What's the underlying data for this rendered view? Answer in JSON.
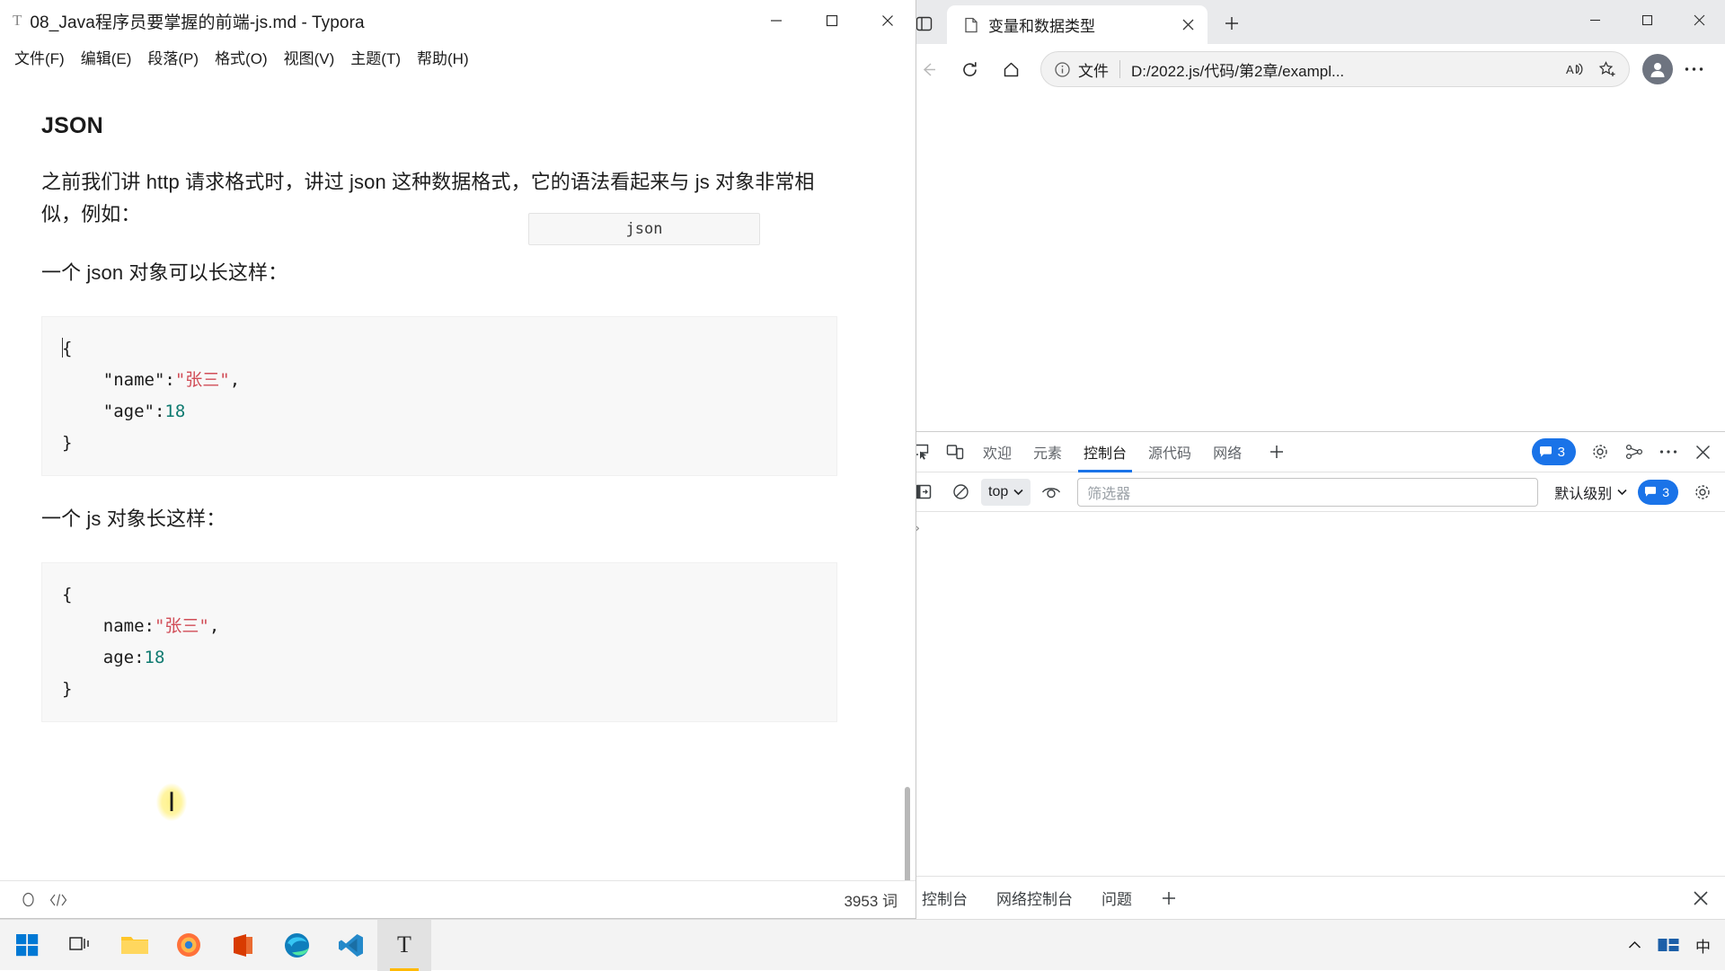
{
  "typora": {
    "app_icon": "typora-icon",
    "title": "08_Java程序员要掌握的前端-js.md - Typora",
    "menus": [
      {
        "label": "文件(F)",
        "name": "menu-file"
      },
      {
        "label": "编辑(E)",
        "name": "menu-edit"
      },
      {
        "label": "段落(P)",
        "name": "menu-paragraph"
      },
      {
        "label": "格式(O)",
        "name": "menu-format"
      },
      {
        "label": "视图(V)",
        "name": "menu-view"
      },
      {
        "label": "主题(T)",
        "name": "menu-theme"
      },
      {
        "label": "帮助(H)",
        "name": "menu-help"
      }
    ],
    "window_buttons": {
      "minimize": "minimize-icon",
      "maximize": "maximize-icon",
      "close": "close-icon"
    },
    "document": {
      "heading": "JSON",
      "paragraph_1": "之前我们讲 http 请求格式时，讲过 json 这种数据格式，它的语法看起来与 js 对象非常相似，例如：",
      "paragraph_2": "一个 json 对象可以长这样：",
      "code_block_1": {
        "language_label": "json",
        "lines": [
          {
            "open": "{"
          },
          {
            "key": "    \"name\":",
            "string": "\"张三\"",
            "after": ","
          },
          {
            "key": "    \"age\":",
            "number": "18"
          },
          {
            "open": "}"
          }
        ]
      },
      "paragraph_3": "一个 js 对象长这样：",
      "code_block_2": {
        "lines": [
          {
            "open": "{"
          },
          {
            "key": "    name:",
            "string": "\"张三\"",
            "after": ","
          },
          {
            "key": "    age:",
            "number": "18"
          },
          {
            "open": "}"
          }
        ]
      }
    },
    "status_bar": {
      "source_mode_icon": "circle-icon",
      "code_view_icon": "code-brackets-icon",
      "word_count": "3953 词"
    }
  },
  "edge": {
    "tab_actions_icon": "tab-actions-icon",
    "tabs": [
      {
        "title": "变量和数据类型",
        "favicon": "page-icon",
        "close_icon": "close-icon",
        "active": true
      }
    ],
    "new_tab_label": "+",
    "window_buttons": {
      "minimize": "minimize-icon",
      "maximize": "maximize-icon",
      "close": "close-icon"
    },
    "toolbar": {
      "back_icon": "back-arrow-icon",
      "refresh_icon": "refresh-icon",
      "home_icon": "home-icon",
      "info_icon": "info-circle-icon",
      "scheme_label": "文件",
      "url": "D:/2022.js/代码/第2章/exampl...",
      "read_aloud_icon": "read-aloud-icon",
      "favorite_icon": "star-add-icon",
      "profile_icon": "profile-avatar-icon",
      "settings_icon": "more-ellipsis-icon"
    }
  },
  "devtools": {
    "inspect_icon": "inspect-element-icon",
    "device_toolbar_icon": "device-toolbar-icon",
    "tabs": [
      {
        "label": "欢迎",
        "name": "tab-welcome",
        "active": false
      },
      {
        "label": "元素",
        "name": "tab-elements",
        "active": false
      },
      {
        "label": "控制台",
        "name": "tab-console",
        "active": true
      },
      {
        "label": "源代码",
        "name": "tab-sources",
        "active": false
      },
      {
        "label": "网络",
        "name": "tab-network",
        "active": false
      }
    ],
    "more_tabs_icon": "plus-icon",
    "issues_badge": "3",
    "settings_icon": "gear-icon",
    "customize_icon": "devtools-customize-icon",
    "more_icon": "more-ellipsis-icon",
    "close_icon": "close-icon",
    "console_toolbar": {
      "sidebar_icon": "console-sidebar-icon",
      "clear_icon": "clear-console-icon",
      "context": "top",
      "context_caret": "chevron-down-icon",
      "eye_icon": "live-expression-icon",
      "filter_placeholder": "筛选器",
      "level": "默认级别",
      "level_caret": "chevron-down-icon",
      "issues_count": "3",
      "console_settings_icon": "gear-icon"
    },
    "prompt_symbol": "›",
    "drawer_tabs": [
      {
        "label": "控制台",
        "name": "drawer-tab-console"
      },
      {
        "label": "网络控制台",
        "name": "drawer-tab-network-console"
      },
      {
        "label": "问题",
        "name": "drawer-tab-issues"
      }
    ],
    "drawer_add_icon": "plus-icon",
    "drawer_close_icon": "close-icon"
  },
  "taskbar": {
    "start_icon": "windows-start-icon",
    "task_view_icon": "task-view-icon",
    "apps": [
      {
        "name": "taskbar-file-explorer",
        "icon": "folder-icon",
        "active": false
      },
      {
        "name": "taskbar-firefox",
        "icon": "firefox-icon",
        "active": false
      },
      {
        "name": "taskbar-office",
        "icon": "office-icon",
        "active": false
      },
      {
        "name": "taskbar-edge",
        "icon": "edge-icon",
        "active": false
      },
      {
        "name": "taskbar-vscode",
        "icon": "vscode-icon",
        "active": false
      },
      {
        "name": "taskbar-typora",
        "icon": "typora-icon",
        "active": true
      }
    ],
    "tray": {
      "chevron_icon": "chevron-up-icon",
      "ime_icon": "ime-grid-icon",
      "ime_label": "中"
    }
  },
  "colors": {
    "accent": "#1a73e8",
    "string_token": "#d14d57",
    "number_token": "#0e7a70",
    "active_app_underline": "#ffb900"
  }
}
